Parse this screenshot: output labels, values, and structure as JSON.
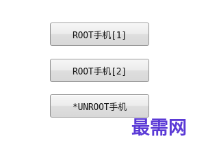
{
  "buttons": {
    "root1": "ROOT手机[1]",
    "root2": "ROOT手机[2]",
    "unroot": "*UNROOT手机"
  },
  "watermark": {
    "text": "最需网",
    "color": "#5b3ad6"
  }
}
